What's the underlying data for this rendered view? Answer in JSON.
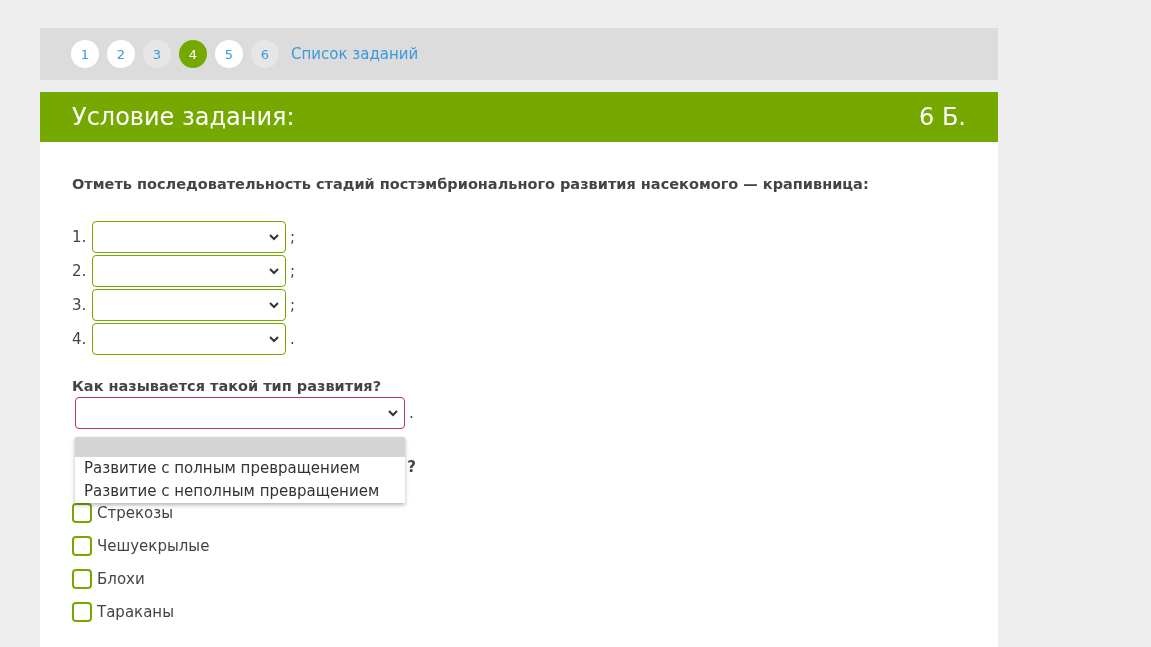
{
  "pagination": {
    "pages": [
      {
        "label": "1",
        "selected": false,
        "visited": false
      },
      {
        "label": "2",
        "selected": false,
        "visited": false
      },
      {
        "label": "3",
        "selected": false,
        "visited": true
      },
      {
        "label": "4",
        "selected": true,
        "visited": false
      },
      {
        "label": "5",
        "selected": false,
        "visited": false
      },
      {
        "label": "6",
        "selected": false,
        "visited": true
      }
    ],
    "list_link": "Список заданий"
  },
  "header": {
    "title": "Условие задания:",
    "points": "6 Б."
  },
  "question_1": {
    "text": "Отметь последовательность стадий постэмбрионального развития насекомого — крапивница:",
    "selects": [
      {
        "number": "1.",
        "end": ";"
      },
      {
        "number": "2.",
        "end": ";"
      },
      {
        "number": "3.",
        "end": ";"
      },
      {
        "number": "4.",
        "end": "."
      }
    ]
  },
  "question_2": {
    "text": "Как называется такой тип развития?",
    "end": ".",
    "open": true,
    "options": [
      {
        "selected": true
      },
      {
        "label": "Развитие с полным превращением",
        "selected": false
      },
      {
        "label": "Развитие с неполным превращением",
        "selected": false
      }
    ]
  },
  "question_3": {
    "text_end": "?",
    "checkboxes": [
      {
        "label": "Стрекозы",
        "checked": false
      },
      {
        "label": "Чешуекрылые",
        "checked": false
      },
      {
        "label": "Блохи",
        "checked": false
      },
      {
        "label": "Тараканы",
        "checked": false
      }
    ]
  }
}
